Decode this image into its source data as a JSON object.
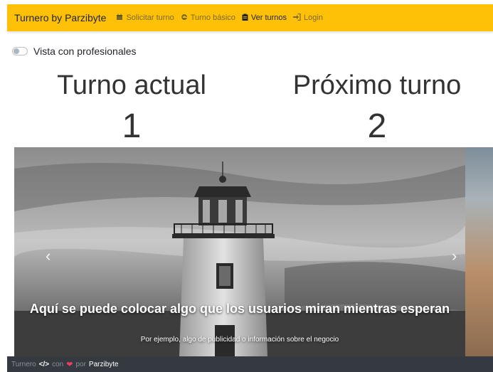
{
  "navbar": {
    "brand": "Turnero by Parzibyte",
    "links": [
      {
        "label": "Solicitar turno",
        "icon": "calendar-icon"
      },
      {
        "label": "Turno básico",
        "icon": "edge-icon"
      },
      {
        "label": "Ver turnos",
        "icon": "clipboard-icon"
      },
      {
        "label": "Login",
        "icon": "sign-in-icon"
      }
    ],
    "color": "#ffc107"
  },
  "toggle": {
    "label": "Vista con profesionales",
    "checked": false
  },
  "current": {
    "title": "Turno actual",
    "number": "1"
  },
  "next": {
    "title": "Próximo turno",
    "number": "2"
  },
  "carousel": {
    "caption_title": "Aquí se puede colocar algo que los usuarios miran mientras esperan",
    "caption_text": "Por ejemplo, algo de publicidad o información sobre el negocio",
    "prev_glyph": "‹",
    "next_glyph": "›"
  },
  "footer": {
    "prefix": "Turnero",
    "code_glyph": "</>",
    "middle": "con",
    "heart_glyph": "❤",
    "by": "por",
    "brand": "Parzibyte",
    "color": "#343a40"
  }
}
